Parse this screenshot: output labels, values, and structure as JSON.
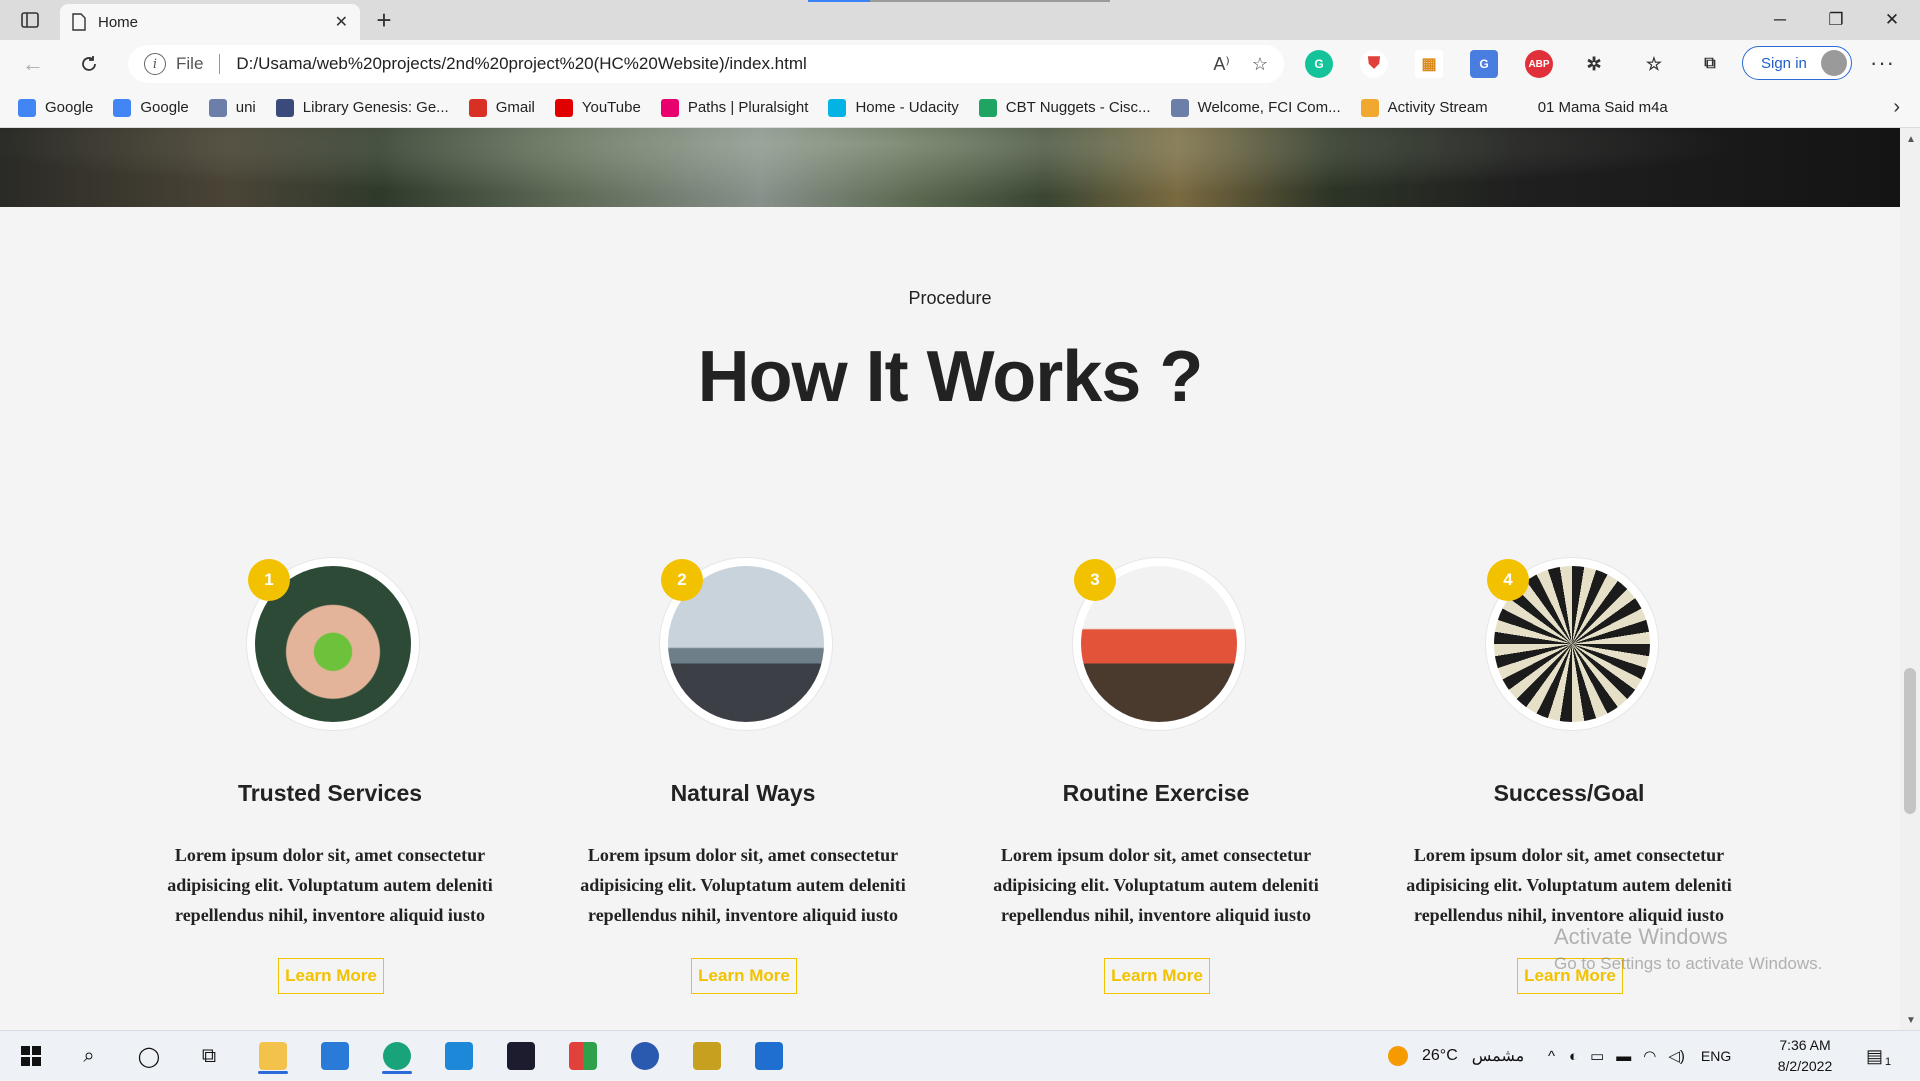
{
  "browser": {
    "tab_title": "Home",
    "address_scheme": "File",
    "url": "D:/Usama/web%20projects/2nd%20project%20(HC%20Website)/index.html",
    "signin_label": "Sign in"
  },
  "bookmarks": [
    {
      "label": "Google",
      "icon": "google-icon",
      "color": "#4285f4"
    },
    {
      "label": "Google",
      "icon": "google-icon",
      "color": "#4285f4"
    },
    {
      "label": "uni",
      "icon": "uni-icon",
      "color": "#6b7fa8"
    },
    {
      "label": "Library Genesis: Ge...",
      "icon": "library-genesis-icon",
      "color": "#3a4a7a"
    },
    {
      "label": "Gmail",
      "icon": "gmail-icon",
      "color": "#d93025"
    },
    {
      "label": "YouTube",
      "icon": "youtube-icon",
      "color": "#e00000"
    },
    {
      "label": "Paths | Pluralsight",
      "icon": "pluralsight-icon",
      "color": "#e8006f"
    },
    {
      "label": "Home - Udacity",
      "icon": "udacity-icon",
      "color": "#02b3e4"
    },
    {
      "label": "CBT Nuggets - Cisc...",
      "icon": "google-drive-icon",
      "color": "#1fa463"
    },
    {
      "label": "Welcome, FCI Com...",
      "icon": "fci-icon",
      "color": "#6b7fa8"
    },
    {
      "label": "Activity Stream",
      "icon": "activity-stream-icon",
      "color": "#f0a830"
    },
    {
      "label": "01 Mama Said m4a",
      "icon": "",
      "color": ""
    }
  ],
  "page": {
    "eyebrow": "Procedure",
    "headline": "How It Works ?",
    "steps": [
      {
        "number": "1",
        "title": "Trusted Services",
        "text": "Lorem ipsum dolor sit, amet consectetur adipisicing elit. Voluptatum autem deleniti repellendus nihil, inventore aliquid iusto",
        "button": "Learn More",
        "image": "apple-in-hands"
      },
      {
        "number": "2",
        "title": "Natural Ways",
        "text": "Lorem ipsum dolor sit, amet consectetur adipisicing elit. Voluptatum autem deleniti repellendus nihil, inventore aliquid iusto",
        "button": "Learn More",
        "image": "cyclist-drinking-by-sea"
      },
      {
        "number": "3",
        "title": "Routine Exercise",
        "text": "Lorem ipsum dolor sit, amet consectetur adipisicing elit. Voluptatum autem deleniti repellendus nihil, inventore aliquid iusto",
        "button": "Learn More",
        "image": "woman-doing-situps"
      },
      {
        "number": "4",
        "title": "Success/Goal",
        "text": "Lorem ipsum dolor sit, amet consectetur adipisicing elit. Voluptatum autem deleniti repellendus nihil, inventore aliquid iusto",
        "button": "Learn More",
        "image": "darts-on-dartboard"
      }
    ]
  },
  "watermark": {
    "line1": "Activate Windows",
    "line2": "Go to Settings to activate Windows."
  },
  "taskbar": {
    "weather_temp": "26°C",
    "weather_text": "مشمس",
    "language": "ENG",
    "time": "7:36 AM",
    "date": "8/2/2022",
    "notification_count": "1"
  },
  "colors": {
    "accent_yellow": "#f2c200",
    "page_bg": "#f4f4f4",
    "edge_blue": "#2a6bd8"
  }
}
